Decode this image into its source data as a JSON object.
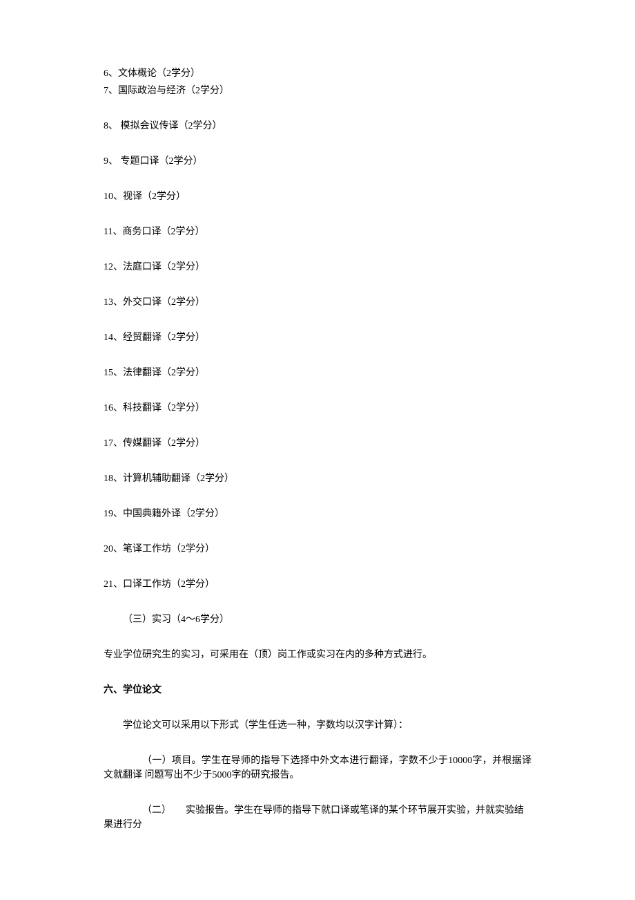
{
  "courses": {
    "c6": "6、文体概论（2学分）",
    "c7": "7、国际政治与经济（2学分）",
    "c8": "8、 模拟会议传译（2学分）",
    "c9": "9、 专题口译（2学分）",
    "c10": "10、视译（2学分）",
    "c11": "11、商务口译（2学分）",
    "c12": "12、法庭口译（2学分）",
    "c13": "13、外交口译（2学分）",
    "c14": "14、经贸翻译（2学分）",
    "c15": "15、法律翻译（2学分）",
    "c16": "16、科技翻译（2学分）",
    "c17": "17、传媒翻译（2学分）",
    "c18": "18、计算机辅助翻译（2学分）",
    "c19": "19、中国典籍外译（2学分）",
    "c20": "20、笔译工作坊（2学分）",
    "c21": "21、口译工作坊（2学分）"
  },
  "sectionThree": "（三）实习（4〜6学分）",
  "internshipText": "专业学位研究生的实习，可采用在（顶）岗工作或实习在内的多种方式进行。",
  "heading6": "六、学位论文",
  "thesisIntro": "学位论文可以采用以下形式（学生任选一种，字数均以汉字计算）：",
  "item1": "（一）项目。学生在导师的指导下选择中外文本进行翻译，字数不少于10000字，并根据译文就翻译 问题写出不少于5000字的研究报告。",
  "item2": "（二）　　实验报告。学生在导师的指导下就口译或笔译的某个环节展开实验，并就实验结果进行分"
}
